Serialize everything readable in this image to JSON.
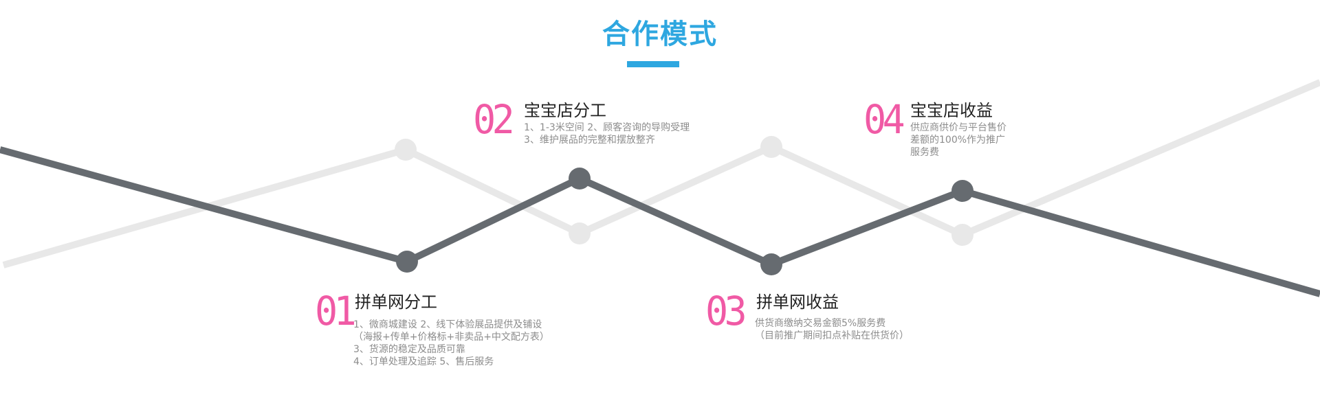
{
  "title": "合作模式",
  "accent": "#2ea7e0",
  "number_color": "#f05aa5",
  "dark_line_color": "#666b70",
  "light_line_color": "#e8e8e8",
  "steps": [
    {
      "number": "01",
      "title": "拼单网分工",
      "lines": [
        "1、微商城建设  2、线下体验展品提供及铺设",
        "（海报+传单+价格标+非卖品+中文配方表）",
        "3、货源的稳定及品质可靠",
        "4、订单处理及追踪   5、售后服务"
      ]
    },
    {
      "number": "02",
      "title": "宝宝店分工",
      "lines": [
        "1、1-3米空间   2、顾客咨询的导购受理",
        "3、维护展品的完整和摆放整齐"
      ]
    },
    {
      "number": "03",
      "title": "拼单网收益",
      "lines": [
        "供货商缴纳交易金额5%服务费",
        "（目前推广期间扣点补贴在供货价）"
      ]
    },
    {
      "number": "04",
      "title": "宝宝店收益",
      "lines": [
        "供应商供价与平台售价",
        "差额的100%作为推广",
        "服务费"
      ]
    }
  ]
}
